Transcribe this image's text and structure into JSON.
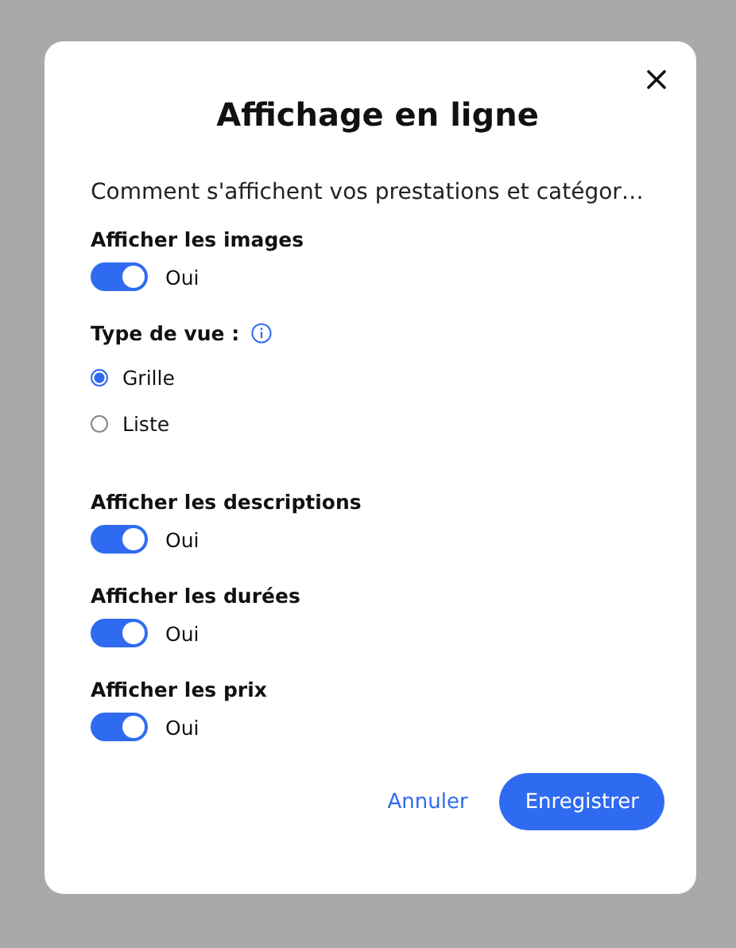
{
  "dialog": {
    "title": "Affichage en ligne",
    "description": "Comment s'affichent vos prestations et catégor…",
    "settings": [
      {
        "kind": "toggle",
        "label": "Afficher les images",
        "on": true,
        "state_text": "Oui"
      },
      {
        "kind": "radio",
        "label": "Type de vue :",
        "info": true,
        "options": [
          {
            "label": "Grille",
            "selected": true
          },
          {
            "label": "Liste",
            "selected": false
          }
        ]
      },
      {
        "kind": "toggle",
        "label": "Afficher les descriptions",
        "on": true,
        "state_text": "Oui"
      },
      {
        "kind": "toggle",
        "label": "Afficher les durées",
        "on": true,
        "state_text": "Oui"
      },
      {
        "kind": "toggle",
        "label": "Afficher les prix",
        "on": true,
        "state_text": "Oui"
      }
    ],
    "buttons": [
      {
        "kind": "link",
        "label": "Annuler"
      },
      {
        "kind": "primary",
        "label": "Enregistrer"
      }
    ]
  }
}
